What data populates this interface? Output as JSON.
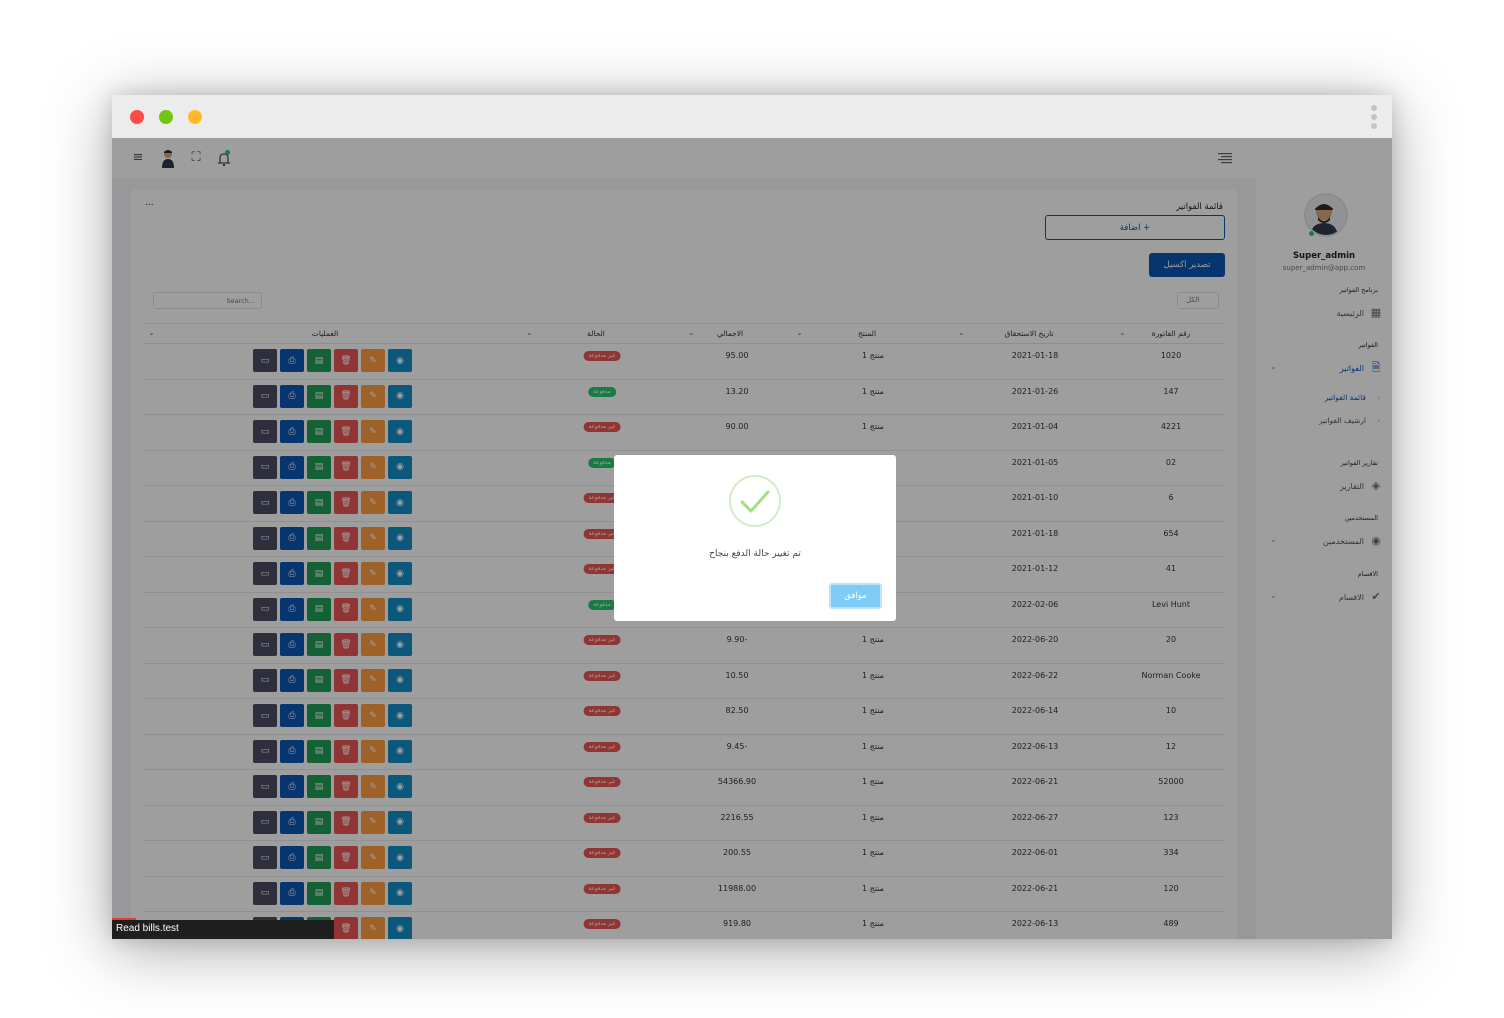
{
  "sidebar": {
    "user_name": "Super_admin",
    "user_email": "super_admin@app.com",
    "sections": {
      "program": "برنامج الفواتير",
      "home": "الرئيسية",
      "invoices_head": "الفواتير",
      "invoices": "الفواتير",
      "invoice_list": "قائمة الفواتير",
      "invoice_archive": "ارشيف الفواتير",
      "reports_head": "تقارير الفواتير",
      "reports": "التقارير",
      "users_head": "المستخدمين",
      "users": "المستخدمين",
      "sections_head": "الاقسام",
      "sections": "الاقسام"
    }
  },
  "card": {
    "title": "قائمة الفواتير",
    "more": "...",
    "add_button": "+ اضافة",
    "export_button": "تصدير اكسيل",
    "search_placeholder": "Search...",
    "filter_value": "الكل"
  },
  "table": {
    "headers": {
      "number": "رقم الفاتورة",
      "due_date": "تاريخ الاستحقاق",
      "product": "المنتج",
      "total": "الاجمالي",
      "status": "الحالة",
      "operations": "العمليات"
    },
    "rows": [
      {
        "number": "1020",
        "due": "2021-01-18",
        "product": "منتج 1",
        "total": "95.00",
        "status": "غير مدفوعة",
        "paid": false
      },
      {
        "number": "147",
        "due": "2021-01-26",
        "product": "منتج 1",
        "total": "13.20",
        "status": "مدفوعة",
        "paid": true
      },
      {
        "number": "4221",
        "due": "2021-01-04",
        "product": "منتج 1",
        "total": "90.00",
        "status": "غير مدفوعة",
        "paid": false
      },
      {
        "number": "02",
        "due": "2021-01-05",
        "product": "",
        "total": "",
        "status": "مدفوعة",
        "paid": true
      },
      {
        "number": "6",
        "due": "2021-01-10",
        "product": "",
        "total": "",
        "status": "غير مدفوعة",
        "paid": false
      },
      {
        "number": "654",
        "due": "2021-01-18",
        "product": "",
        "total": "",
        "status": "غير مدفوعة",
        "paid": false
      },
      {
        "number": "41",
        "due": "2021-01-12",
        "product": "",
        "total": "",
        "status": "غير مدفوعة",
        "paid": false
      },
      {
        "number": "Levi Hunt",
        "due": "2022-02-06",
        "product": "",
        "total": "",
        "status": "مدفوعة",
        "paid": true
      },
      {
        "number": "20",
        "due": "2022-06-20",
        "product": "منتج 1",
        "total": "9.90-",
        "status": "غير مدفوعة",
        "paid": false
      },
      {
        "number": "Norman Cooke",
        "due": "2022-06-22",
        "product": "منتج 1",
        "total": "10.50",
        "status": "غير مدفوعة",
        "paid": false
      },
      {
        "number": "10",
        "due": "2022-06-14",
        "product": "منتج 1",
        "total": "82.50",
        "status": "غير مدفوعة",
        "paid": false
      },
      {
        "number": "12",
        "due": "2022-06-13",
        "product": "منتج 1",
        "total": "9.45-",
        "status": "غير مدفوعة",
        "paid": false
      },
      {
        "number": "52000",
        "due": "2022-06-21",
        "product": "منتج 1",
        "total": "54366.90",
        "status": "غير مدفوعة",
        "paid": false
      },
      {
        "number": "123",
        "due": "2022-06-27",
        "product": "منتج 1",
        "total": "2216.55",
        "status": "غير مدفوعة",
        "paid": false
      },
      {
        "number": "334",
        "due": "2022-06-01",
        "product": "منتج 1",
        "total": "200.55",
        "status": "غير مدفوعة",
        "paid": false
      },
      {
        "number": "120",
        "due": "2022-06-21",
        "product": "منتج 1",
        "total": "11988.00",
        "status": "غير مدفوعة",
        "paid": false
      },
      {
        "number": "489",
        "due": "2022-06-13",
        "product": "منتج 1",
        "total": "919.80",
        "status": "غير مدفوعة",
        "paid": false
      }
    ]
  },
  "modal": {
    "message": "تم تغيير حالة الدفع بنجاح",
    "ok_button": "موافق"
  },
  "statusbar": {
    "text": "Read bills.test"
  },
  "colors": {
    "primary": "#0b56b5",
    "danger": "#ea5455",
    "success": "#28c76f",
    "modal_button": "#7ecbf5"
  }
}
